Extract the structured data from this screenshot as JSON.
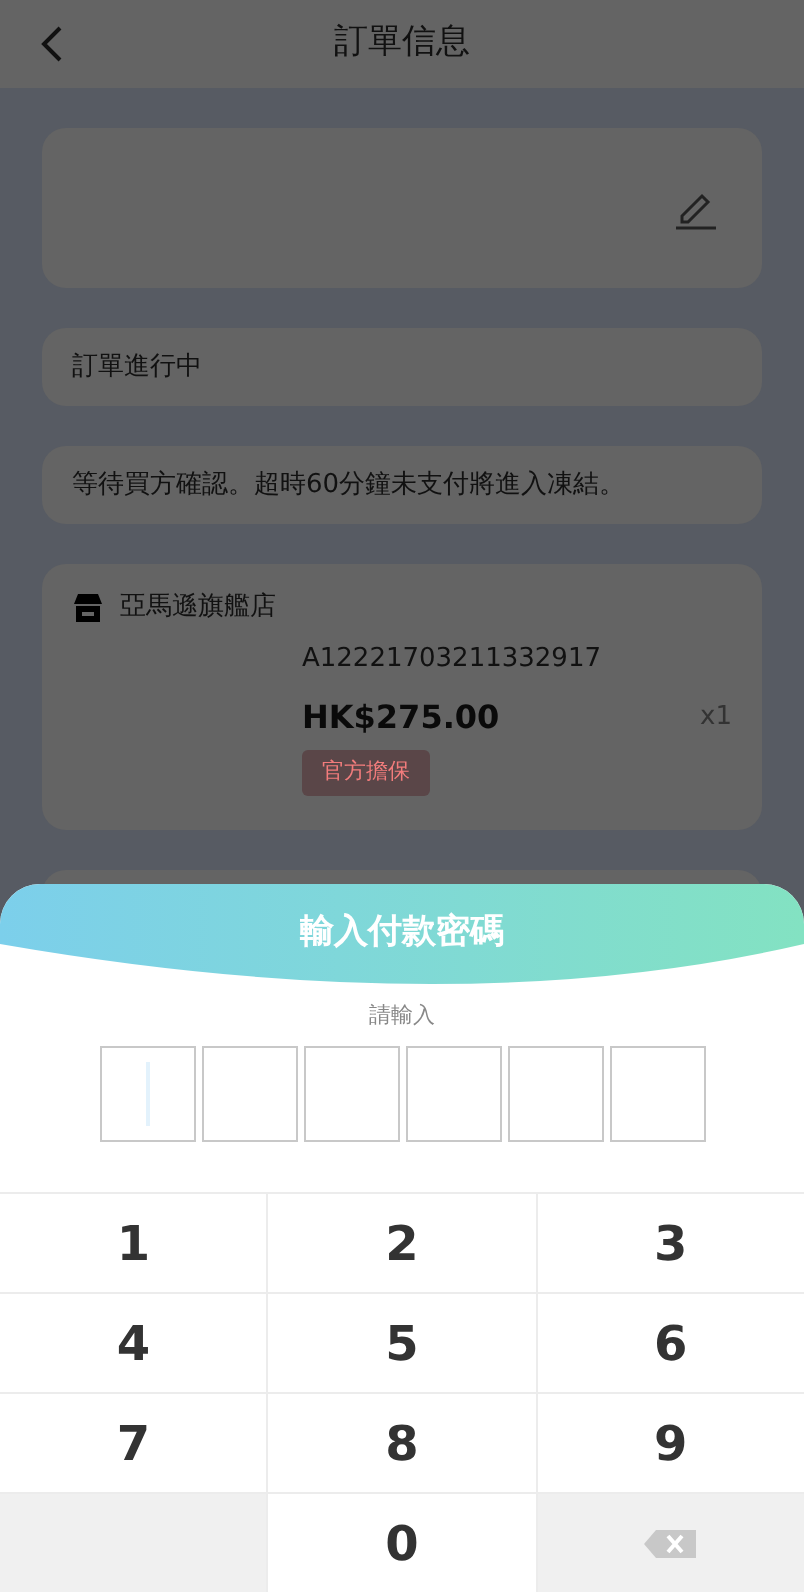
{
  "header": {
    "title": "訂單信息"
  },
  "status": {
    "text": "訂單進行中"
  },
  "notice": {
    "text": "等待買方確認。超時60分鐘未支付將進入凍結。"
  },
  "order": {
    "store": "亞馬遜旗艦店",
    "code": "A12221703211332917",
    "price": "HK$275.00",
    "quantity": "x1",
    "tag": "官方擔保"
  },
  "payment_sheet": {
    "title": "輸入付款密碼",
    "prompt": "請輸入",
    "pin_boxes": [
      {
        "focused": true
      },
      {
        "focused": false
      },
      {
        "focused": false
      },
      {
        "focused": false
      },
      {
        "focused": false
      },
      {
        "focused": false
      }
    ],
    "keys": [
      {
        "kind": "digit",
        "label": "1"
      },
      {
        "kind": "digit",
        "label": "2"
      },
      {
        "kind": "digit",
        "label": "3"
      },
      {
        "kind": "digit",
        "label": "4"
      },
      {
        "kind": "digit",
        "label": "5"
      },
      {
        "kind": "digit",
        "label": "6"
      },
      {
        "kind": "digit",
        "label": "7"
      },
      {
        "kind": "digit",
        "label": "8"
      },
      {
        "kind": "digit",
        "label": "9"
      },
      {
        "kind": "blank"
      },
      {
        "kind": "digit",
        "label": "0"
      },
      {
        "kind": "backspace"
      }
    ]
  }
}
